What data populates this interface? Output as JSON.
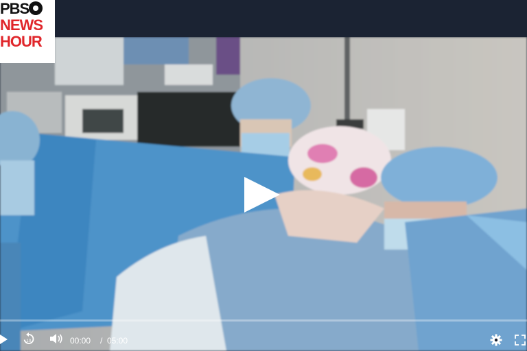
{
  "brand": {
    "logo_lines": [
      "PBS",
      "NEWS",
      "HOUR"
    ],
    "logo_text_color": "#111111",
    "logo_accent_color": "#e0262b"
  },
  "player": {
    "current_time": "00:00",
    "duration": "05:00",
    "progress_fraction": 0.0,
    "icons": {
      "play_overlay": "play-icon",
      "play": "play-icon",
      "rewind": "rewind-10-icon",
      "volume": "volume-icon",
      "settings": "gear-icon",
      "fullscreen": "fullscreen-icon"
    }
  }
}
